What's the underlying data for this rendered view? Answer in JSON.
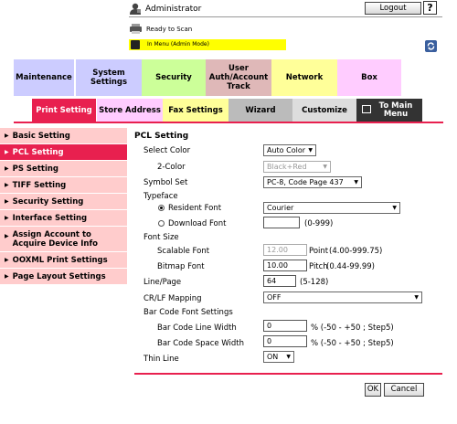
{
  "header": {
    "user": "Administrator",
    "logout_label": "Logout",
    "help_label": "?",
    "status": "Ready to Scan",
    "mode": "In Menu (Admin Mode)"
  },
  "colors": {
    "accent": "#e8204f",
    "mode_bar": "#ffff00"
  },
  "main_tabs": [
    {
      "label": "Maintenance",
      "color": "#ccccff"
    },
    {
      "label": "System Settings",
      "color": "#ccccff"
    },
    {
      "label": "Security",
      "color": "#ccff99"
    },
    {
      "label": "User Auth/Account Track",
      "color": "#dfb8b8"
    },
    {
      "label": "Network",
      "color": "#ffff99"
    },
    {
      "label": "Box",
      "color": "#ffccff"
    }
  ],
  "sub_tabs": [
    {
      "label": "Print Setting",
      "color": "#e8204f"
    },
    {
      "label": "Store Address",
      "color": "#ffccff"
    },
    {
      "label": "Fax Settings",
      "color": "#ffff99"
    },
    {
      "label": "Wizard",
      "color": "#bbbbbb"
    },
    {
      "label": "Customize",
      "color": "#dddddd"
    },
    {
      "label": "To Main Menu",
      "color": "#333333"
    }
  ],
  "sidebar": [
    {
      "label": "Basic Setting",
      "active": false
    },
    {
      "label": "PCL Setting",
      "active": true
    },
    {
      "label": "PS Setting",
      "active": false
    },
    {
      "label": "TIFF Setting",
      "active": false
    },
    {
      "label": "Security Setting",
      "active": false
    },
    {
      "label": "Interface Setting",
      "active": false
    },
    {
      "label": "Assign Account to Acquire Device Info",
      "active": false
    },
    {
      "label": "OOXML Print Settings",
      "active": false
    },
    {
      "label": "Page Layout Settings",
      "active": false
    }
  ],
  "content": {
    "title": "PCL Setting",
    "select_color": {
      "label": "Select Color",
      "value": "Auto Color"
    },
    "two_color": {
      "label": "2-Color",
      "value": "Black+Red"
    },
    "symbol_set": {
      "label": "Symbol Set",
      "value": "PC-8, Code Page 437"
    },
    "typeface": {
      "label": "Typeface"
    },
    "resident_font": {
      "label": "Resident Font",
      "value": "Courier"
    },
    "download_font": {
      "label": "Download Font",
      "value": "",
      "range": "(0-999)"
    },
    "font_size": {
      "label": "Font Size"
    },
    "scalable_font": {
      "label": "Scalable Font",
      "value": "12.00",
      "unit": "Point",
      "range": "(4.00-999.75)"
    },
    "bitmap_font": {
      "label": "Bitmap Font",
      "value": "10.00",
      "unit": "Pitch",
      "range": "(0.44-99.99)"
    },
    "line_page": {
      "label": "Line/Page",
      "value": "64",
      "range": "(5-128)"
    },
    "crlf": {
      "label": "CR/LF Mapping",
      "value": "OFF"
    },
    "barcode": {
      "label": "Bar Code Font Settings"
    },
    "barcode_line": {
      "label": "Bar Code Line Width",
      "value": "0",
      "hint": "%  (-50  -  +50 ; Step5)"
    },
    "barcode_space": {
      "label": "Bar Code Space Width",
      "value": "0",
      "hint": "%  (-50  -  +50 ; Step5)"
    },
    "thin_line": {
      "label": "Thin Line",
      "value": "ON"
    },
    "ok_label": "OK",
    "cancel_label": "Cancel"
  }
}
